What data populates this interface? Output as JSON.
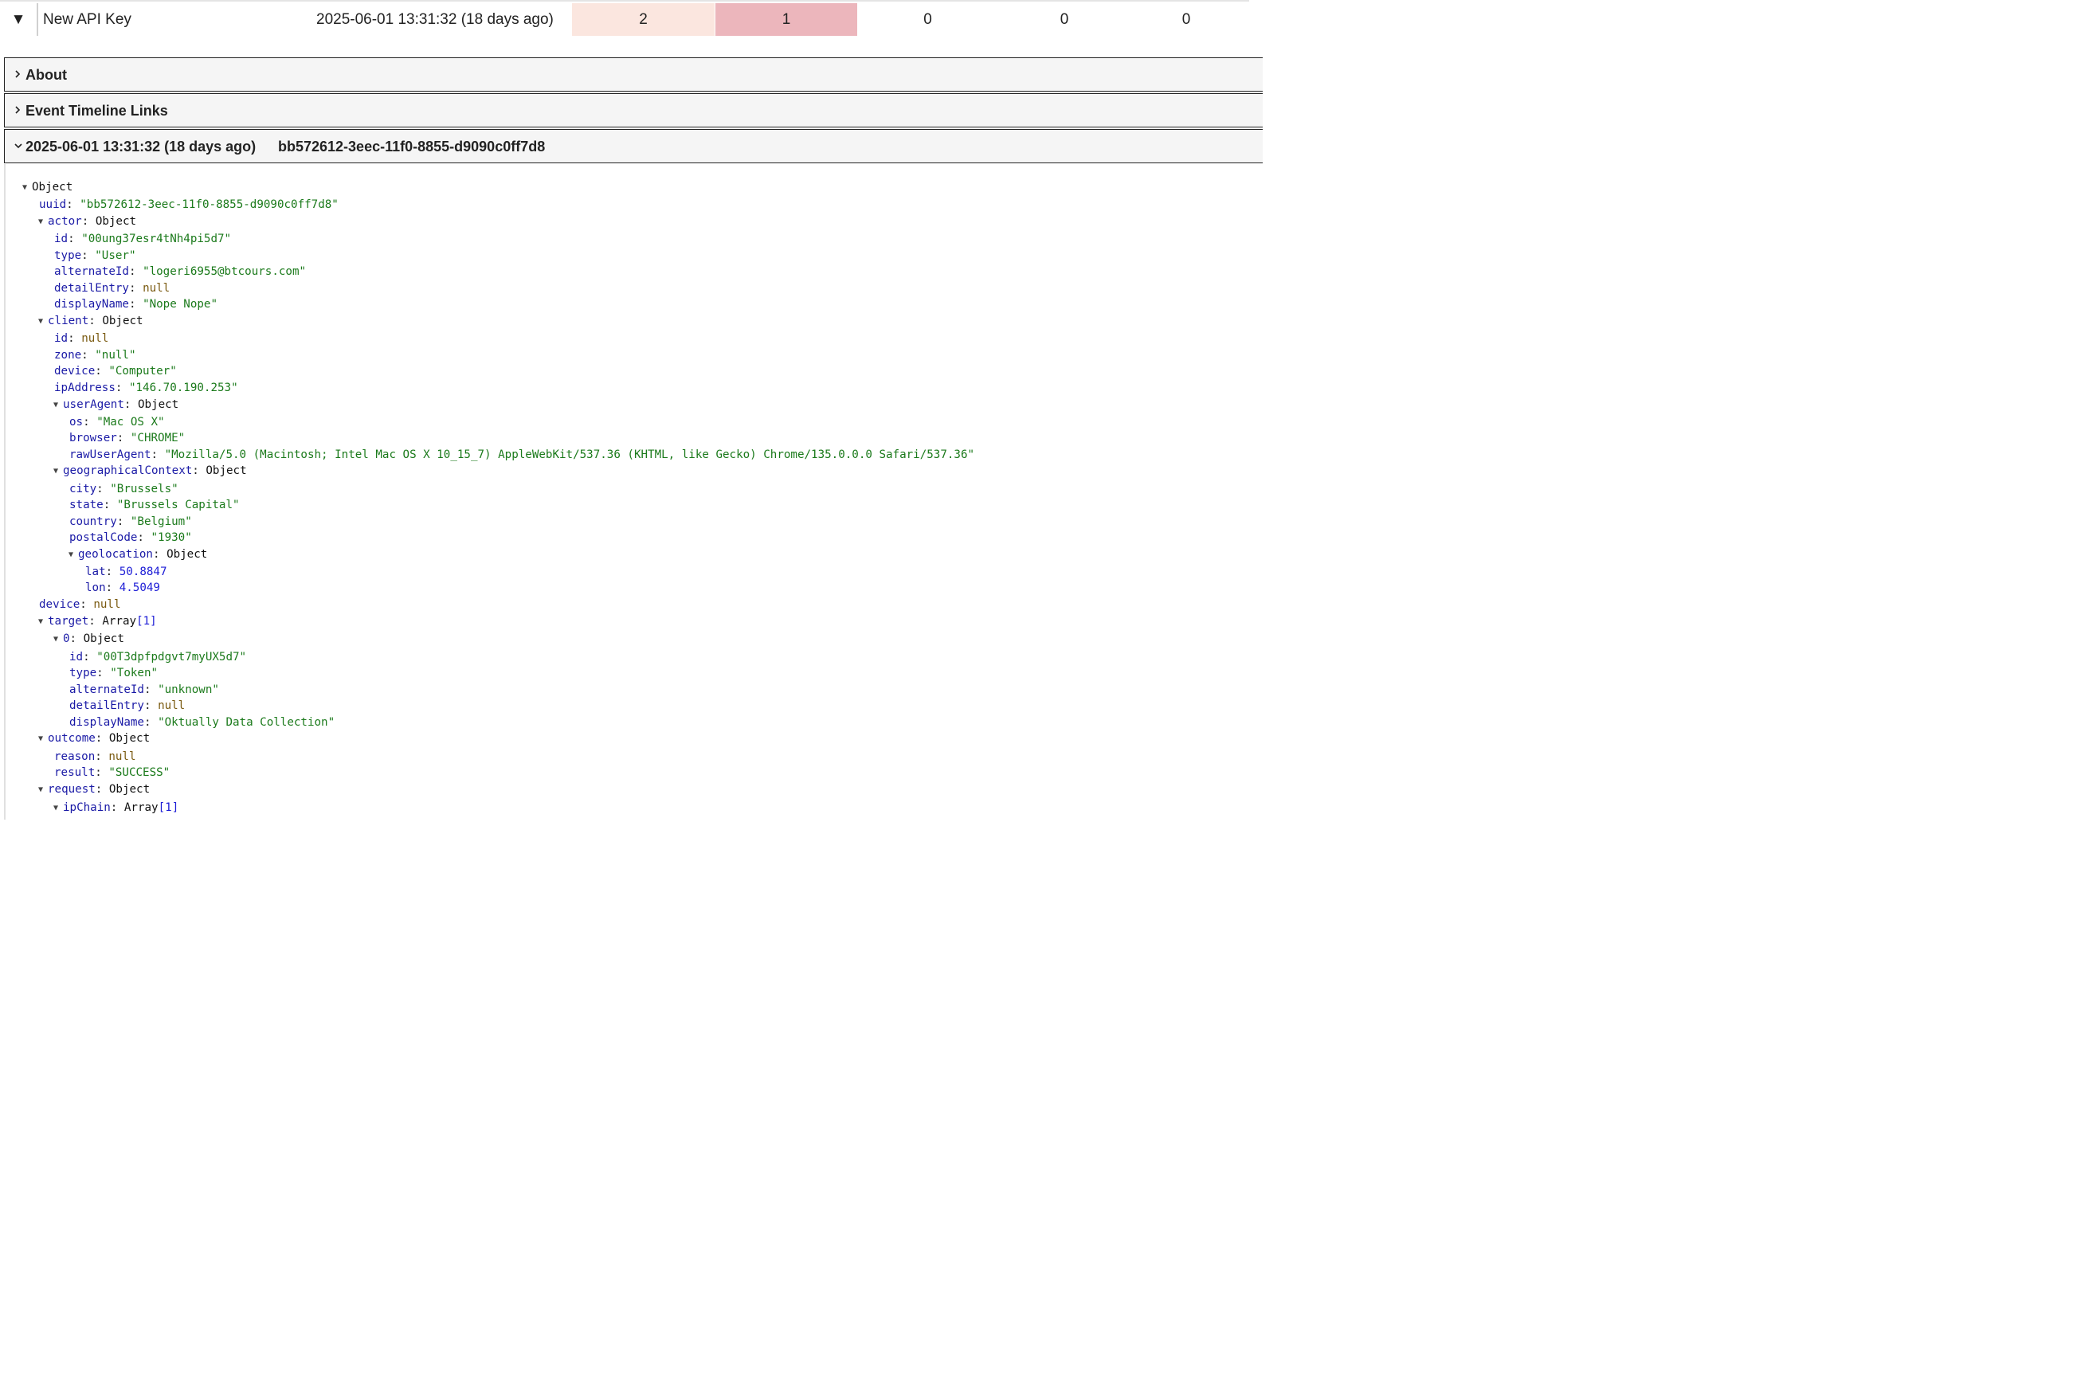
{
  "top_row": {
    "toggle": "▼",
    "name": "New API Key",
    "date": "2025-06-01 13:31:32 (18 days ago)",
    "counts": [
      "2",
      "1",
      "0",
      "0",
      "0"
    ],
    "count_colors": [
      "#fbe6df",
      "#ecb6bc"
    ]
  },
  "sections": {
    "about": "About",
    "timeline_links": "Event Timeline Links",
    "event_date": "2025-06-01 13:31:32 (18 days ago)",
    "event_uuid": "bb572612-3eec-11f0-8855-d9090c0ff7d8"
  },
  "tree": {
    "root": "Object",
    "uuid": "\"bb572612-3eec-11f0-8855-d9090c0ff7d8\"",
    "actor": {
      "label": "Object",
      "id": "\"00ung37esr4tNh4pi5d7\"",
      "type": "\"User\"",
      "alternateId": "\"logeri6955@btcours.com\"",
      "detailEntry": "null",
      "displayName": "\"Nope Nope\""
    },
    "client": {
      "label": "Object",
      "id": "null",
      "zone": "\"null\"",
      "device": "\"Computer\"",
      "ipAddress": "\"146.70.190.253\"",
      "userAgent": {
        "label": "Object",
        "os": "\"Mac OS X\"",
        "browser": "\"CHROME\"",
        "rawUserAgent": "\"Mozilla/5.0 (Macintosh; Intel Mac OS X 10_15_7) AppleWebKit/537.36 (KHTML, like Gecko) Chrome/135.0.0.0 Safari/537.36\""
      },
      "geographicalContext": {
        "label": "Object",
        "city": "\"Brussels\"",
        "state": "\"Brussels Capital\"",
        "country": "\"Belgium\"",
        "postalCode": "\"1930\"",
        "geolocation": {
          "label": "Object",
          "lat": "50.8847",
          "lon": "4.5049"
        }
      }
    },
    "device": "null",
    "target": {
      "label": "Array",
      "count": "[1]",
      "item0": {
        "label": "Object",
        "id": "\"00T3dpfpdgvt7myUX5d7\"",
        "type": "\"Token\"",
        "alternateId": "\"unknown\"",
        "detailEntry": "null",
        "displayName": "\"Oktually Data Collection\""
      }
    },
    "outcome": {
      "label": "Object",
      "reason": "null",
      "result": "\"SUCCESS\""
    },
    "request": {
      "label": "Object",
      "ipChain": {
        "label": "Array",
        "count": "[1]"
      }
    }
  }
}
